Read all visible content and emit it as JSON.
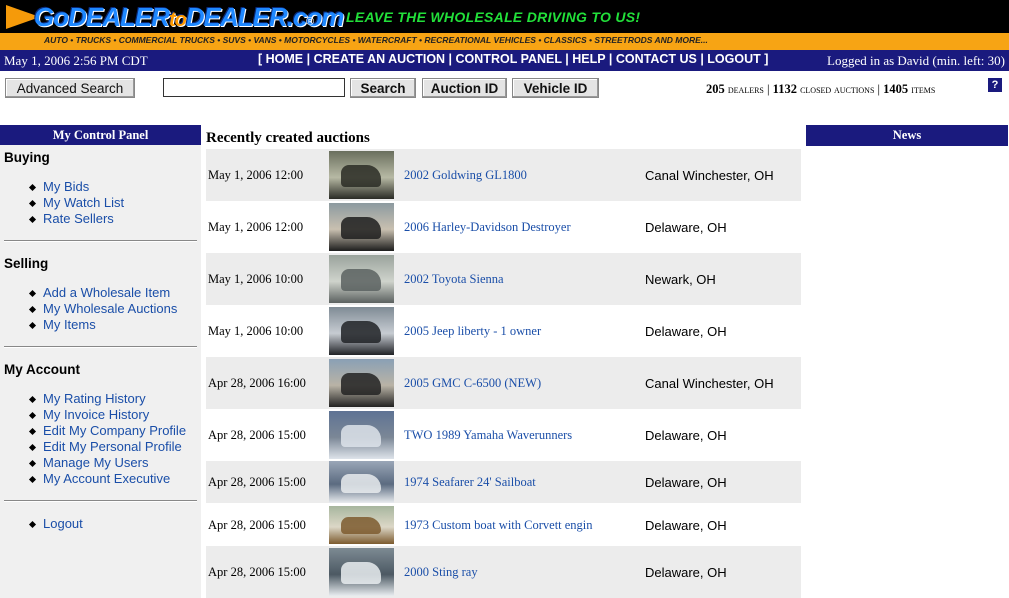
{
  "header": {
    "logo": {
      "go": "Go",
      "dealer1": "DEALER",
      "to": "to",
      "dealer2": "DEALER",
      "dotcom": ".com",
      "reg": "®"
    },
    "tagline": "LEAVE THE WHOLESALE DRIVING TO US!",
    "categories": "AUTO • TRUCKS • COMMERCIAL TRUCKS • SUVS • VANS • MOTORCYCLES • WATERCRAFT • RECREATIONAL VEHICLES • CLASSICS • STREETRODS AND MORE...",
    "colors": {
      "black_bar": "#000000",
      "orange_bar": "#f7a414",
      "navy": "#1a1a7e",
      "green": "#22e03a"
    }
  },
  "nav": {
    "datetime": "May 1, 2006 2:56 PM CDT",
    "links": [
      "HOME",
      "CREATE AN AUCTION",
      "CONTROL PANEL",
      "HELP",
      "CONTACT US",
      "LOGOUT"
    ],
    "user": "Logged in as David (min. left: 30)"
  },
  "search": {
    "advanced_label": "Advanced Search",
    "input_value": "",
    "search_label": "Search",
    "auction_id_label": "Auction ID",
    "vehicle_id_label": "Vehicle ID"
  },
  "stats": {
    "dealers_count": "205",
    "dealers_label": "dealers",
    "closed_count": "1132",
    "closed_label": "closed auctions",
    "items_count": "1405",
    "items_label": "items",
    "help_icon": "?"
  },
  "sidebar": {
    "title": "My Control Panel",
    "sections": [
      {
        "title": "Buying",
        "items": [
          "My Bids",
          "My Watch List",
          "Rate Sellers"
        ]
      },
      {
        "title": "Selling",
        "items": [
          "Add a Wholesale Item",
          "My Wholesale Auctions",
          "My Items"
        ]
      },
      {
        "title": "My Account",
        "items": [
          "My Rating History",
          "My Invoice History",
          "Edit My Company Profile",
          "Edit My Personal Profile",
          "Manage My Users",
          "My Account Executive"
        ]
      }
    ],
    "logout": "Logout"
  },
  "main": {
    "title": "Recently created auctions",
    "auctions": [
      {
        "date": "May 1, 2006 12:00",
        "title": "2002 Goldwing GL1800",
        "location": "Canal Winchester, OH",
        "thumb": "motorcycle-photo"
      },
      {
        "date": "May 1, 2006 12:00",
        "title": "2006 Harley-Davidson Destroyer",
        "location": "Delaware, OH",
        "thumb": "dragbike-photo"
      },
      {
        "date": "May 1, 2006 10:00",
        "title": "2002 Toyota Sienna",
        "location": "Newark, OH",
        "thumb": "minivan-photo"
      },
      {
        "date": "May 1, 2006 10:00",
        "title": "2005 Jeep liberty - 1 owner",
        "location": "Delaware, OH",
        "thumb": "suv-photo"
      },
      {
        "date": "Apr 28, 2006 16:00",
        "title": "2005 GMC C-6500 (NEW)",
        "location": "Canal Winchester, OH",
        "thumb": "dumptruck-photo"
      },
      {
        "date": "Apr 28, 2006 15:00",
        "title": "TWO 1989 Yamaha Waverunners",
        "location": "Delaware, OH",
        "thumb": "waverunner-photo"
      },
      {
        "date": "Apr 28, 2006 15:00",
        "title": "1974 Seafarer 24' Sailboat",
        "location": "Delaware, OH",
        "thumb": "sailboat-photo"
      },
      {
        "date": "Apr 28, 2006 15:00",
        "title": "1973 Custom boat with Corvett engin",
        "location": "Delaware, OH",
        "thumb": "speedboat-photo"
      },
      {
        "date": "Apr 28, 2006 15:00",
        "title": "2000 Sting ray",
        "location": "Delaware, OH",
        "thumb": "boat-photo"
      }
    ]
  },
  "news": {
    "title": "News"
  }
}
